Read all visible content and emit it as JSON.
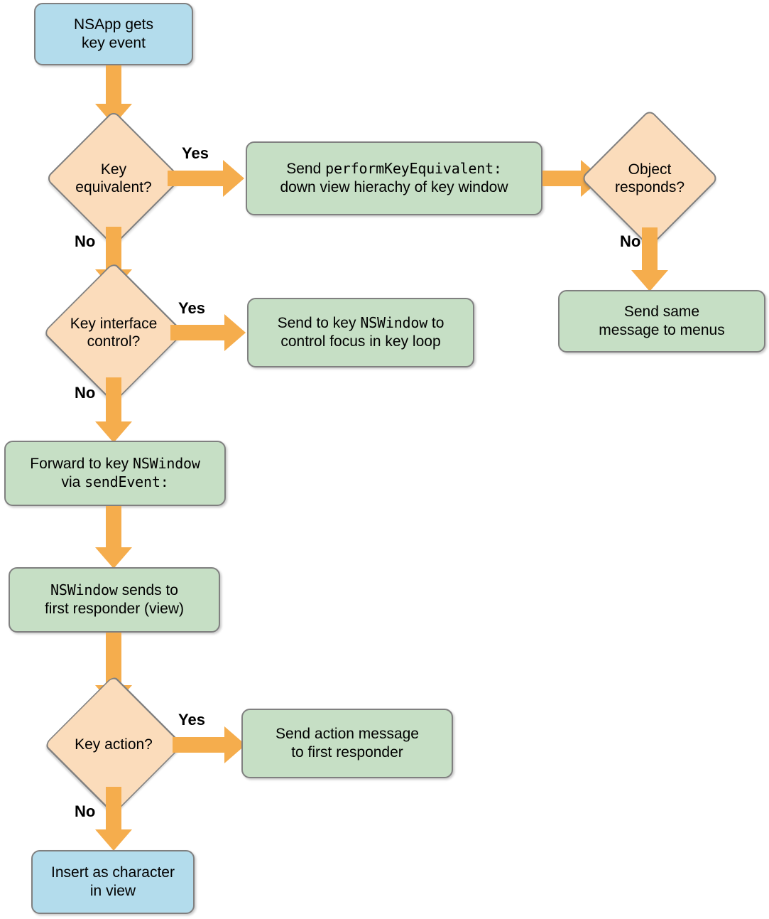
{
  "diagram": {
    "title": "NSApp key event dispatch flowchart",
    "colors": {
      "start_fill": "#b3dcec",
      "process_fill": "#c6dfc5",
      "decision_fill": "#fbdcbb",
      "arrow": "#f5ad4d",
      "stroke": "#808080",
      "text": "#000000"
    },
    "nodes": {
      "start": {
        "type": "terminator",
        "line1": "NSApp gets",
        "line2": "key event"
      },
      "key_equivalent": {
        "type": "decision",
        "line1": "Key",
        "line2": "equivalent?"
      },
      "send_perform_key_equivalent": {
        "type": "process",
        "line1_pre": "Send ",
        "line1_code": "performKeyEquivalent:",
        "line2": "down view hierachy of key window"
      },
      "object_responds": {
        "type": "decision",
        "line1": "Object",
        "line2": "responds?"
      },
      "send_same_message_to_menus": {
        "type": "process",
        "line1": "Send same",
        "line2": "message to menus"
      },
      "key_interface_control": {
        "type": "decision",
        "line1": "Key interface",
        "line2": "control?"
      },
      "send_to_key_nswindow": {
        "type": "process",
        "line1_pre": "Send to key ",
        "line1_code": "NSWindow",
        "line1_post": " to",
        "line2": "control focus in key loop"
      },
      "forward_to_key_nswindow": {
        "type": "process",
        "line1_pre": "Forward to key ",
        "line1_code": "NSWindow",
        "line2_pre": "via ",
        "line2_code": "sendEvent:"
      },
      "nswindow_sends_to_first_responder": {
        "type": "process",
        "line1_code": "NSWindow",
        "line1_post": " sends to",
        "line2": "first responder (view)"
      },
      "key_action": {
        "type": "decision",
        "line1": "Key action?"
      },
      "send_action_message": {
        "type": "process",
        "line1": "Send action message",
        "line2": "to first responder"
      },
      "insert_as_character": {
        "type": "terminator",
        "line1": "Insert as character",
        "line2": "in view"
      }
    },
    "branch_labels": {
      "key_equivalent_yes": "Yes",
      "key_equivalent_no": "No",
      "object_responds_no": "No",
      "key_interface_control_yes": "Yes",
      "key_interface_control_no": "No",
      "key_action_yes": "Yes",
      "key_action_no": "No"
    }
  }
}
